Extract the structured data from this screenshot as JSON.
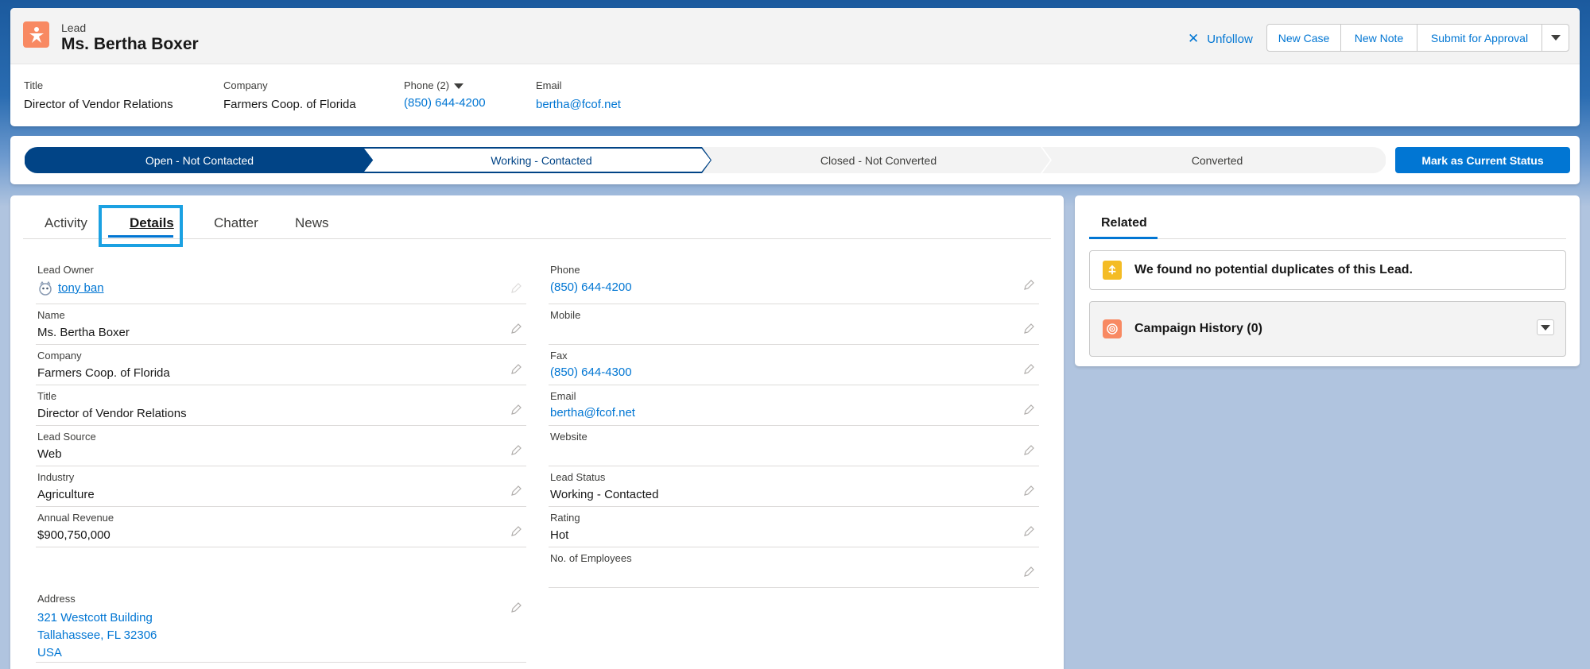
{
  "colors": {
    "brand": "#0176d3",
    "path_current": "#014486",
    "lead_icon": "#f88962",
    "duplicate_icon": "#f4bc25",
    "focus_ring": "#1ba1e2"
  },
  "header": {
    "object_type": "Lead",
    "record_name": "Ms. Bertha Boxer",
    "icon": "lead-icon",
    "unfollow_label": "Unfollow",
    "actions": [
      "New Case",
      "New Note",
      "Submit for Approval"
    ],
    "fields": {
      "title_label": "Title",
      "title_value": "Director of Vendor Relations",
      "company_label": "Company",
      "company_value": "Farmers Coop. of Florida",
      "phone_label": "Phone (2)",
      "phone_value": "(850) 644-4200",
      "email_label": "Email",
      "email_value": "bertha@fcof.net"
    }
  },
  "path": {
    "stages": [
      "Open - Not Contacted",
      "Working - Contacted",
      "Closed - Not Converted",
      "Converted"
    ],
    "mark_button": "Mark as Current Status"
  },
  "tabs": [
    "Activity",
    "Details",
    "Chatter",
    "News"
  ],
  "details": {
    "left": [
      {
        "label": "Lead Owner",
        "value": "tony ban"
      },
      {
        "label": "Name",
        "value": "Ms. Bertha Boxer"
      },
      {
        "label": "Company",
        "value": "Farmers Coop. of Florida"
      },
      {
        "label": "Title",
        "value": "Director of Vendor Relations"
      },
      {
        "label": "Lead Source",
        "value": "Web"
      },
      {
        "label": "Industry",
        "value": "Agriculture"
      },
      {
        "label": "Annual Revenue",
        "value": "$900,750,000"
      },
      {
        "label": "Address",
        "line1": "321 Westcott Building",
        "line2": "Tallahassee, FL 32306",
        "line3": "USA"
      }
    ],
    "right": [
      {
        "label": "Phone",
        "value": "(850) 644-4200"
      },
      {
        "label": "Mobile",
        "value": ""
      },
      {
        "label": "Fax",
        "value": "(850) 644-4300"
      },
      {
        "label": "Email",
        "value": "bertha@fcof.net"
      },
      {
        "label": "Website",
        "value": ""
      },
      {
        "label": "Lead Status",
        "value": "Working - Contacted"
      },
      {
        "label": "Rating",
        "value": "Hot"
      },
      {
        "label": "No. of Employees",
        "value": ""
      }
    ]
  },
  "related": {
    "tab_label": "Related",
    "duplicates_text": "We found no potential duplicates of this Lead.",
    "campaign_history": "Campaign History (0)"
  }
}
